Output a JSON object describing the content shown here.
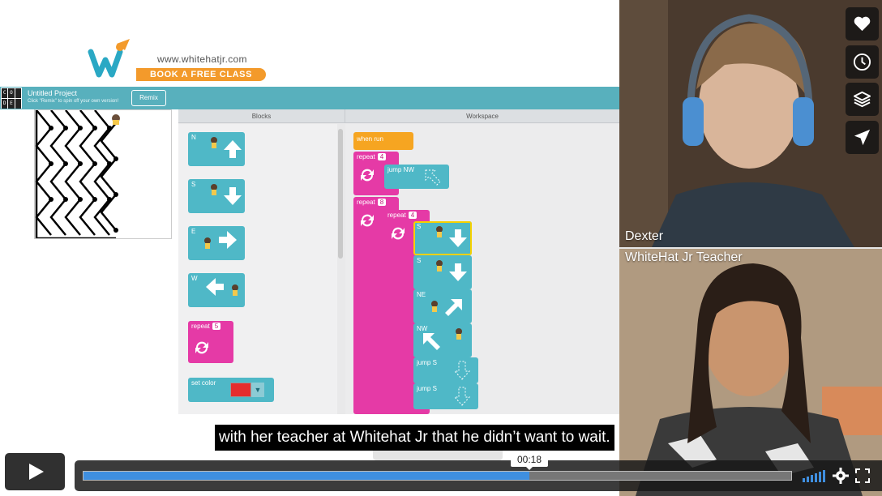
{
  "brand": {
    "url": "www.whitehatjr.com",
    "cta": "BOOK A FREE CLASS",
    "colors": {
      "orange": "#f39a2b",
      "teal": "#2aa8c4"
    }
  },
  "project": {
    "title": "Untitled Project",
    "subtitle": "Click \"Remix\" to spin off your own version!",
    "remix_label": "Remix",
    "logo_letters": [
      "C",
      "O",
      "D",
      "E"
    ]
  },
  "editor": {
    "blocks_header": "Blocks",
    "workspace_header": "Workspace",
    "toolbox": {
      "n_label": "N",
      "s_label": "S",
      "e_label": "E",
      "w_label": "W",
      "repeat_label": "repeat",
      "repeat_count": "5",
      "set_color_label": "set color"
    },
    "workspace": {
      "when_run": "when run",
      "repeat1_label": "repeat",
      "repeat1_count": "4",
      "jump_nw": "jump  NW",
      "repeat2_label": "repeat",
      "repeat2_count": "8",
      "repeat3_label": "repeat",
      "repeat3_count": "4",
      "s1": "S",
      "s2": "S",
      "ne": "NE",
      "nw": "NW",
      "jump_s1": "jump  S",
      "jump_s2": "jump  S"
    }
  },
  "video": {
    "student_name": "Dexter",
    "teacher_name": "WhiteHat Jr Teacher",
    "subtitle": "with her teacher at Whitehat Jr that he didn’t want to wait.",
    "time": "00:18",
    "progress": 0.63
  },
  "side_icons": [
    "heart-icon",
    "clock-icon",
    "layers-icon",
    "send-icon"
  ]
}
